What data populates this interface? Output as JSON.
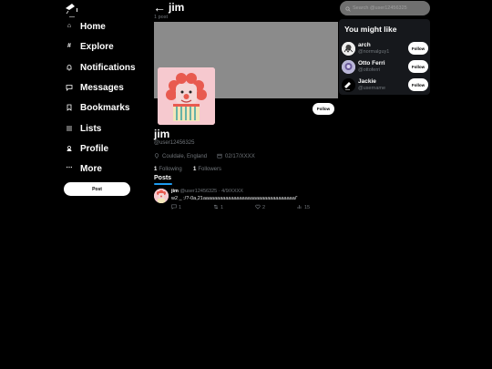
{
  "sidebar": {
    "items": [
      {
        "icon": "home-icon",
        "glyph": "⌂",
        "label": "Home"
      },
      {
        "icon": "hashtag-icon",
        "glyph": "#",
        "label": "Explore"
      },
      {
        "icon": "bell-icon",
        "glyph": "♪",
        "label": "Notifications"
      },
      {
        "icon": "message-icon",
        "glyph": "▭",
        "label": "Messages"
      },
      {
        "icon": "bookmark-icon",
        "glyph": "▯",
        "label": "Bookmarks"
      },
      {
        "icon": "list-icon",
        "glyph": "≡",
        "label": "Lists"
      },
      {
        "icon": "profile-icon",
        "glyph": "♙",
        "label": "Profile"
      },
      {
        "icon": "more-icon",
        "glyph": "⋯",
        "label": "More"
      }
    ],
    "post_label": "Post"
  },
  "header": {
    "back_glyph": "←",
    "name": "jim",
    "post_count": "1 post"
  },
  "profile": {
    "follow_label": "Follow",
    "name": "jim",
    "handle": "@user12456325",
    "location": "Couldale, England",
    "joined": "02/17/XXXX",
    "following_count": "1",
    "following_label": "Following",
    "followers_count": "1",
    "followers_label": "Followers"
  },
  "tabs": {
    "posts": "Posts"
  },
  "tweet": {
    "name": "jim",
    "handle_date": "@user12456325 · 4/9/XXXX",
    "text": "w2 _ :/?-0a,21aaaaaaaaaaaaaaaaaaaaaaaaaaaaaaaaa/'",
    "replies": "1",
    "retweets": "1",
    "likes": "2",
    "views": "15"
  },
  "search": {
    "placeholder": "Search @user12456325"
  },
  "suggestions": {
    "title": "You might like",
    "users": [
      {
        "name": "arch",
        "handle": "@normalguy1",
        "follow": "Follow"
      },
      {
        "name": "Otto Ferri",
        "handle": "@ottoferri",
        "follow": "Follow"
      },
      {
        "name": "Jackie",
        "handle": "@username",
        "follow": "Follow"
      }
    ]
  },
  "colors": {
    "accent": "#1d9bf0",
    "background": "#000000",
    "banner": "#8b8b8b"
  }
}
